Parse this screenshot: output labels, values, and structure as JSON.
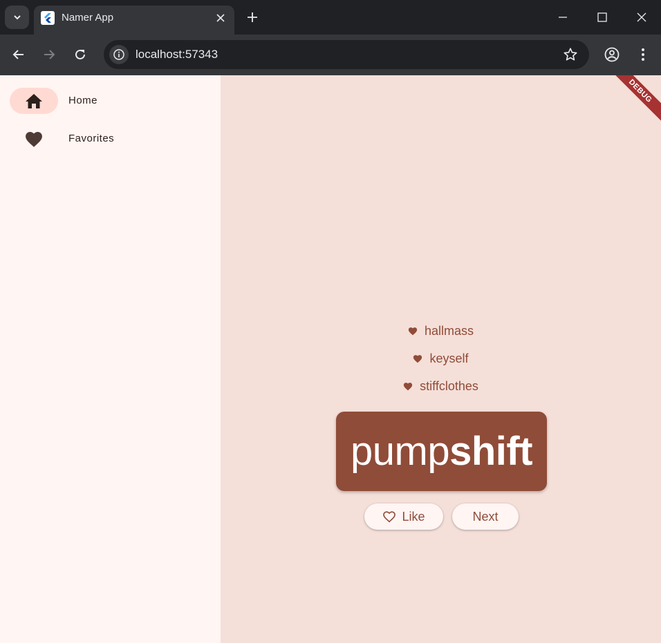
{
  "browser": {
    "tab_title": "Namer App",
    "url": "localhost:57343"
  },
  "app": {
    "nav": [
      {
        "label": "Home",
        "icon": "home-icon",
        "selected": true
      },
      {
        "label": "Favorites",
        "icon": "heart-icon",
        "selected": false
      }
    ],
    "favorites": [
      "hallmass",
      "keyself",
      "stiffclothes"
    ],
    "current_pair": {
      "first": "pump",
      "second": "shift"
    },
    "buttons": {
      "like": "Like",
      "next": "Next"
    },
    "debug_banner": "DEBUG",
    "colors": {
      "primary": "#8f4c38",
      "background": "#f5dfd9",
      "rail": "#fff5f3",
      "indicator": "#ffdad2"
    }
  }
}
